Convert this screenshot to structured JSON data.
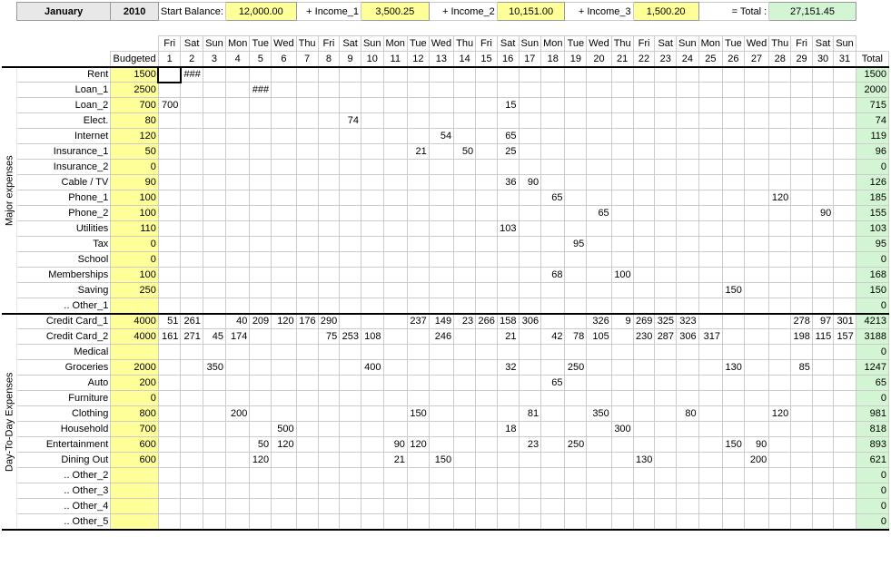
{
  "header": {
    "month": "January",
    "year": "2010",
    "start_balance_label": "Start Balance:",
    "start_balance": "12,000.00",
    "income1_label": "+ Income_1",
    "income1": "3,500.25",
    "income2_label": "+ Income_2",
    "income2": "10,151.00",
    "income3_label": "+ Income_3",
    "income3": "1,500.20",
    "total_label": "= Total :",
    "total": "27,151.45"
  },
  "columns": {
    "budgeted": "Budgeted",
    "total": "Total"
  },
  "weekdays": [
    "Fri",
    "Sat",
    "Sun",
    "Mon",
    "Tue",
    "Wed",
    "Thu",
    "Fri",
    "Sat",
    "Sun",
    "Mon",
    "Tue",
    "Wed",
    "Thu",
    "Fri",
    "Sat",
    "Sun",
    "Mon",
    "Tue",
    "Wed",
    "Thu",
    "Fri",
    "Sat",
    "Sun",
    "Mon",
    "Tue",
    "Wed",
    "Thu",
    "Fri",
    "Sat",
    "Sun"
  ],
  "daynums": [
    "1",
    "2",
    "3",
    "4",
    "5",
    "6",
    "7",
    "8",
    "9",
    "10",
    "11",
    "12",
    "13",
    "14",
    "15",
    "16",
    "17",
    "18",
    "19",
    "20",
    "21",
    "22",
    "23",
    "24",
    "25",
    "26",
    "27",
    "28",
    "29",
    "30",
    "31"
  ],
  "section_labels": {
    "major": "Major expenses",
    "day": "Day-To-Day Expenses"
  },
  "rows": [
    {
      "section": "major",
      "label": "Rent",
      "budget": "1500",
      "total": "1500",
      "days": {
        "2": "###"
      }
    },
    {
      "section": "major",
      "label": "Loan_1",
      "budget": "2500",
      "total": "2000",
      "days": {
        "5": "###"
      }
    },
    {
      "section": "major",
      "label": "Loan_2",
      "budget": "700",
      "total": "715",
      "days": {
        "1": "700",
        "16": "15"
      }
    },
    {
      "section": "major",
      "label": "Elect.",
      "budget": "80",
      "total": "74",
      "days": {
        "9": "74"
      }
    },
    {
      "section": "major",
      "label": "Internet",
      "budget": "120",
      "total": "119",
      "days": {
        "13": "54",
        "16": "65"
      }
    },
    {
      "section": "major",
      "label": "Insurance_1",
      "budget": "50",
      "total": "96",
      "days": {
        "12": "21",
        "14": "50",
        "16": "25"
      }
    },
    {
      "section": "major",
      "label": "Insurance_2",
      "budget": "0",
      "total": "0",
      "days": {}
    },
    {
      "section": "major",
      "label": "Cable / TV",
      "budget": "90",
      "total": "126",
      "days": {
        "16": "36",
        "17": "90"
      }
    },
    {
      "section": "major",
      "label": "Phone_1",
      "budget": "100",
      "total": "185",
      "days": {
        "18": "65",
        "28": "120"
      }
    },
    {
      "section": "major",
      "label": "Phone_2",
      "budget": "100",
      "total": "155",
      "days": {
        "20": "65",
        "30": "90"
      }
    },
    {
      "section": "major",
      "label": "Utilities",
      "budget": "110",
      "total": "103",
      "days": {
        "16": "103"
      }
    },
    {
      "section": "major",
      "label": "Tax",
      "budget": "0",
      "total": "95",
      "days": {
        "19": "95"
      }
    },
    {
      "section": "major",
      "label": "School",
      "budget": "0",
      "total": "0",
      "days": {}
    },
    {
      "section": "major",
      "label": "Memberships",
      "budget": "100",
      "total": "168",
      "days": {
        "18": "68",
        "21": "100"
      }
    },
    {
      "section": "major",
      "label": "Saving",
      "budget": "250",
      "total": "150",
      "days": {
        "26": "150"
      }
    },
    {
      "section": "major",
      "label": ".. Other_1",
      "budget": "",
      "total": "0",
      "days": {}
    },
    {
      "section": "day",
      "label": "Credit Card_1",
      "budget": "4000",
      "total": "4213",
      "days": {
        "1": "51",
        "2": "261",
        "4": "40",
        "5": "209",
        "6": "120",
        "7": "176",
        "8": "290",
        "12": "237",
        "13": "149",
        "14": "23",
        "15": "266",
        "16": "158",
        "17": "306",
        "20": "326",
        "21": "9",
        "22": "269",
        "23": "325",
        "24": "323",
        "29": "278",
        "30": "97",
        "31": "301"
      }
    },
    {
      "section": "day",
      "label": "Credit Card_2",
      "budget": "4000",
      "total": "3188",
      "days": {
        "1": "161",
        "2": "271",
        "3": "45",
        "4": "174",
        "8": "75",
        "9": "253",
        "10": "108",
        "13": "246",
        "16": "21",
        "18": "42",
        "19": "78",
        "20": "105",
        "22": "230",
        "23": "287",
        "24": "306",
        "25": "317",
        "29": "198",
        "30": "115",
        "31": "157"
      }
    },
    {
      "section": "day",
      "label": "Medical",
      "budget": "",
      "total": "0",
      "days": {}
    },
    {
      "section": "day",
      "label": "Groceries",
      "budget": "2000",
      "total": "1247",
      "days": {
        "3": "350",
        "10": "400",
        "16": "32",
        "19": "250",
        "26": "130",
        "29": "85"
      }
    },
    {
      "section": "day",
      "label": "Auto",
      "budget": "200",
      "total": "65",
      "days": {
        "18": "65"
      }
    },
    {
      "section": "day",
      "label": "Furniture",
      "budget": "0",
      "total": "0",
      "days": {}
    },
    {
      "section": "day",
      "label": "Clothing",
      "budget": "800",
      "total": "981",
      "days": {
        "4": "200",
        "12": "150",
        "17": "81",
        "20": "350",
        "24": "80",
        "28": "120"
      }
    },
    {
      "section": "day",
      "label": "Household",
      "budget": "700",
      "total": "818",
      "days": {
        "6": "500",
        "16": "18",
        "21": "300"
      }
    },
    {
      "section": "day",
      "label": "Entertainment",
      "budget": "600",
      "total": "893",
      "days": {
        "5": "50",
        "6": "120",
        "11": "90",
        "12": "120",
        "17": "23",
        "19": "250",
        "26": "150",
        "27": "90"
      }
    },
    {
      "section": "day",
      "label": "Dining Out",
      "budget": "600",
      "total": "621",
      "days": {
        "5": "120",
        "11": "21",
        "13": "150",
        "22": "130",
        "27": "200"
      }
    },
    {
      "section": "day",
      "label": ".. Other_2",
      "budget": "",
      "total": "0",
      "days": {}
    },
    {
      "section": "day",
      "label": ".. Other_3",
      "budget": "",
      "total": "0",
      "days": {}
    },
    {
      "section": "day",
      "label": ".. Other_4",
      "budget": "",
      "total": "0",
      "days": {}
    },
    {
      "section": "day",
      "label": ".. Other_5",
      "budget": "",
      "total": "0",
      "days": {}
    }
  ]
}
